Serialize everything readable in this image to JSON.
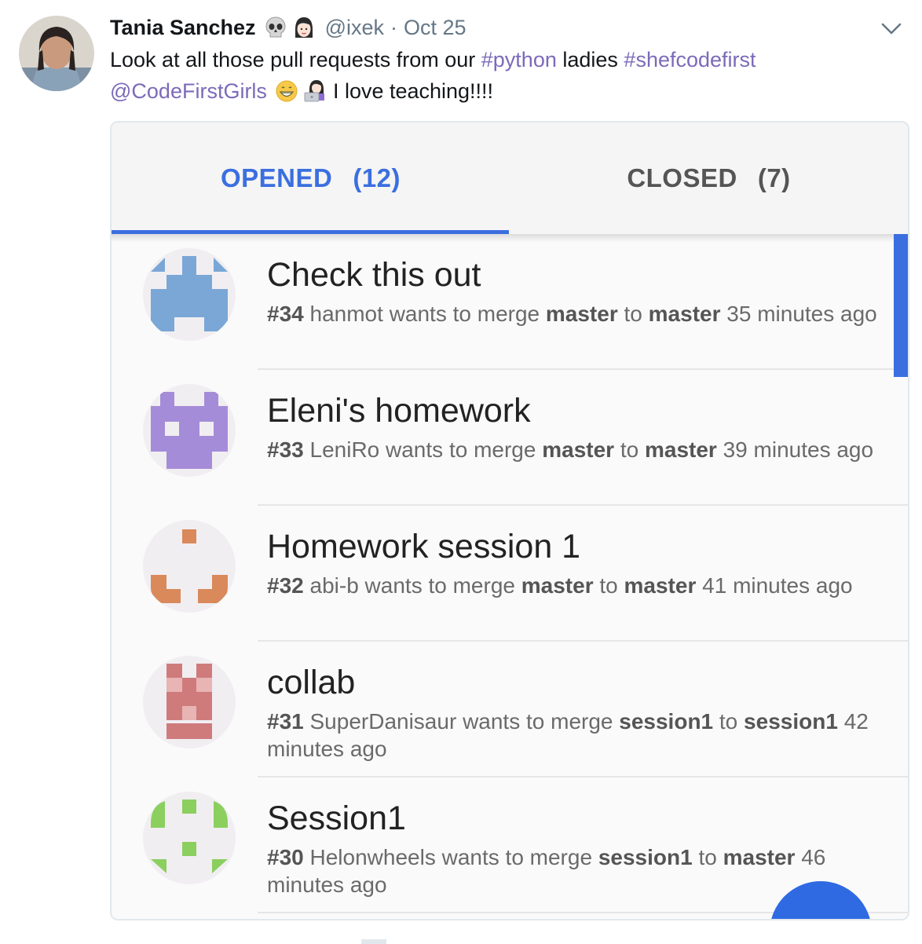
{
  "tweet": {
    "author_name": "Tania Sanchez",
    "handle": "@ixek",
    "separator": "·",
    "date": "Oct 25",
    "text_line1": [
      {
        "t": "Look at all those pull requests from our ",
        "link": false
      },
      {
        "t": "#python",
        "link": true
      },
      {
        "t": " ladies ",
        "link": false
      },
      {
        "t": "#shefcodefirst",
        "link": true
      }
    ],
    "text_line2": [
      {
        "t": "@CodeFirstGirls",
        "link": true
      },
      {
        "t": "I love teaching!!!!",
        "link": false
      }
    ]
  },
  "tabs": {
    "opened_label": "OPENED",
    "opened_count": "(12)",
    "closed_label": "CLOSED",
    "closed_count": "(7)",
    "active": "opened"
  },
  "colors": {
    "accent": "#3b6fe0",
    "link": "#7c6ab9"
  },
  "pull_requests": [
    {
      "title": "Check this out",
      "number": "#34",
      "user": "hanmot",
      "from": "master",
      "to": "master",
      "time_a": "35 minutes",
      "time_b": "ago",
      "avatar_color": "#7aa7d6"
    },
    {
      "title": "Eleni's homework",
      "number": "#33",
      "user": "LeniRo",
      "from": "master",
      "to": "master",
      "time_a": "39 minutes",
      "time_b": "ago",
      "avatar_color": "#a58cd8"
    },
    {
      "title": "Homework session 1",
      "number": "#32",
      "user": "abi-b",
      "from": "master",
      "to": "master",
      "time_a": "41 minutes",
      "time_b": "ago",
      "avatar_color": "#d9895a"
    },
    {
      "title": "collab",
      "number": "#31",
      "user": "SuperDanisaur",
      "from": "session1",
      "to": "session1",
      "time_a": "",
      "time_b": "42 minutes ago",
      "avatar_color": "#cf7b7b"
    },
    {
      "title": "Session1",
      "number": "#30",
      "user": "Helonwheels",
      "from": "session1",
      "to": "master",
      "time_a": "46",
      "time_b": "minutes ago",
      "avatar_color": "#8bcf5f"
    }
  ],
  "sub_words": {
    "wants": "wants to merge",
    "to": "to"
  }
}
